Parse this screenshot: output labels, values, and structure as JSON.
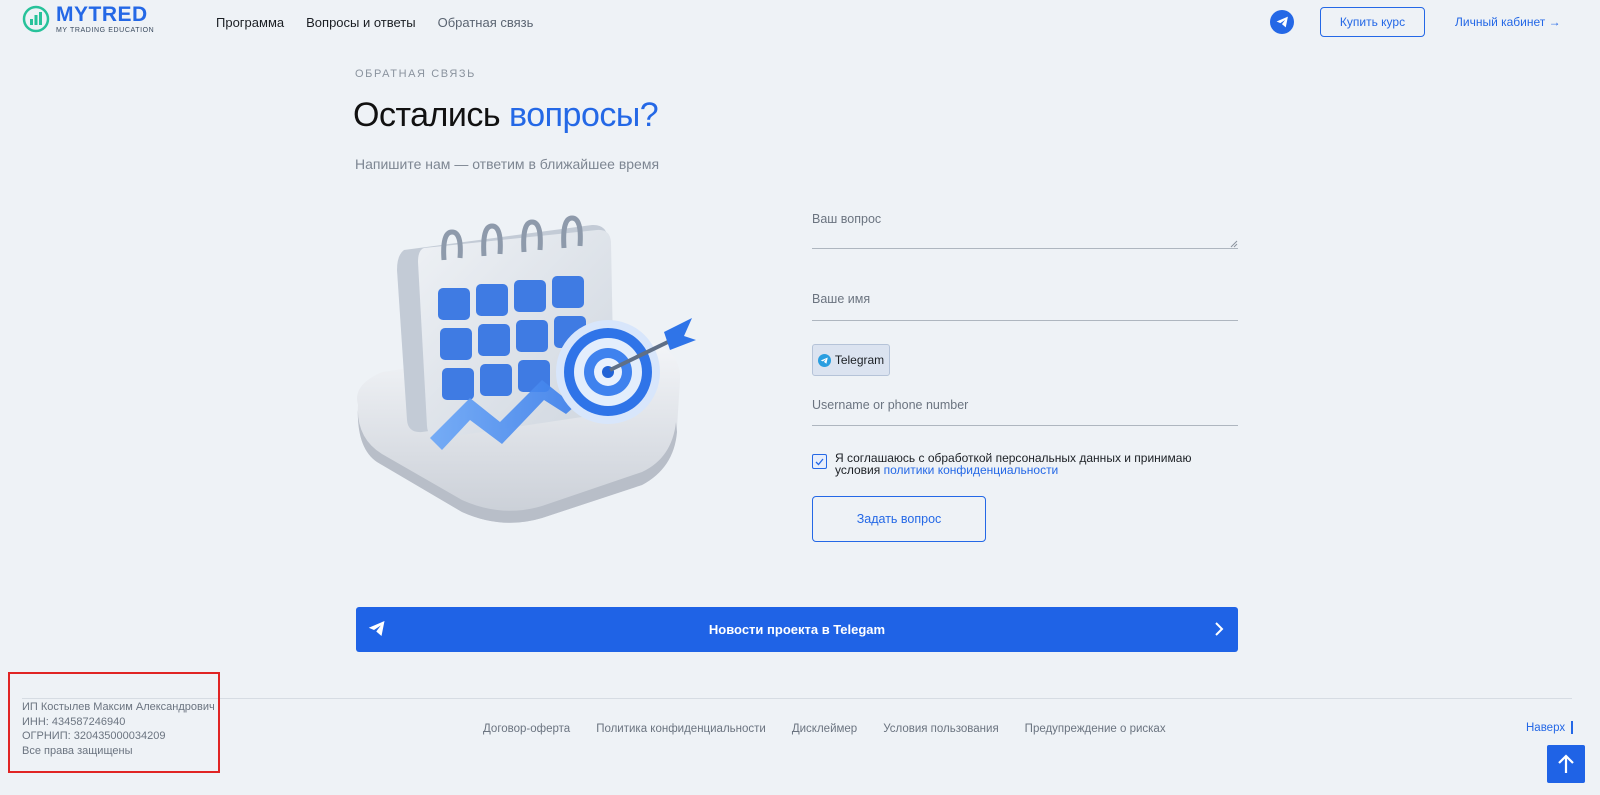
{
  "header": {
    "logo_name": "MYTRED",
    "logo_sub": "MY TRADING EDUCATION",
    "nav": [
      {
        "label": "Программа"
      },
      {
        "label": "Вопросы и ответы"
      },
      {
        "label": "Обратная связь"
      }
    ],
    "buy_label": "Купить курс",
    "cabinet_label": "Личный кабинет →"
  },
  "section": {
    "eyebrow": "ОБРАТНАЯ СВЯЗЬ",
    "title_main": "Остались ",
    "title_accent": "вопросы?",
    "subtitle": "Напишите нам — ответим в ближайшее время"
  },
  "form": {
    "question_label": "Ваш вопрос",
    "name_label": "Ваше имя",
    "messenger_label": "Telegram",
    "username_placeholder": "Username or phone number",
    "consent_text": "Я соглашаюсь с обработкой персональных данных и принимаю условия ",
    "consent_link": "политики конфиденциальности",
    "submit_label": "Задать вопрос",
    "consent_checked": true
  },
  "news_banner": {
    "label": "Новости проекта в Telegam"
  },
  "footer": {
    "legal": [
      "ИП Костылев Максим Александрович",
      "ИНН: 434587246940",
      "ОГРНИП: 320435000034209",
      "Все права защищены"
    ],
    "links": [
      {
        "label": "Договор-оферта"
      },
      {
        "label": "Политика конфиденциальности"
      },
      {
        "label": "Дисклеймер"
      },
      {
        "label": "Условия пользования"
      },
      {
        "label": "Предупреждение о рисках"
      }
    ],
    "to_top_label": "Наверх"
  },
  "colors": {
    "accent": "#2468e6",
    "background": "#eef2f6",
    "banner": "#1f63e6",
    "highlight": "#e02424"
  }
}
